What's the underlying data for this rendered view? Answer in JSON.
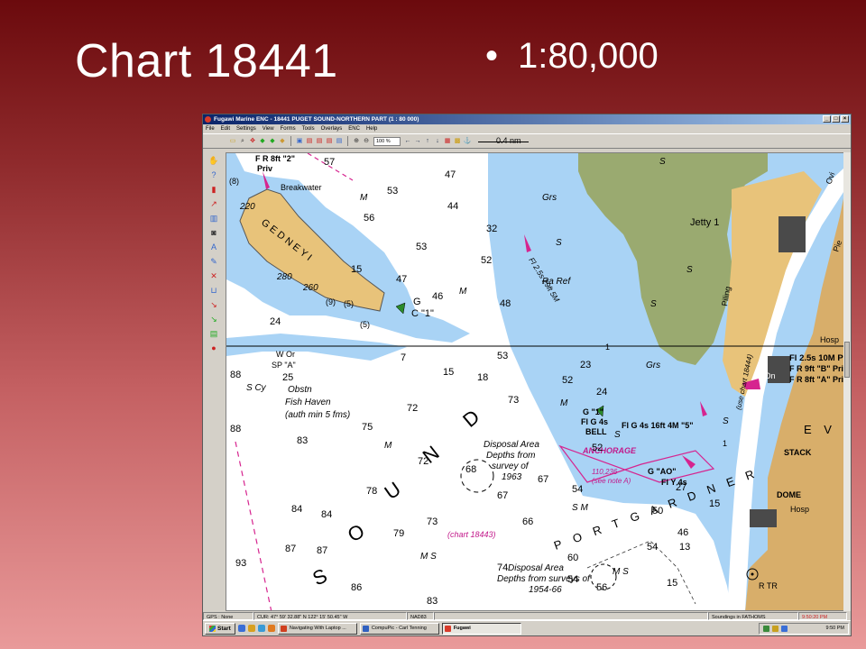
{
  "slide": {
    "title": "Chart 18441",
    "bullet": "1:80,000"
  },
  "window": {
    "title": "Fugawi Marine ENC - 18441 PUGET SOUND-NORTHERN PART (1 : 80 000)",
    "buttons": [
      "_",
      "□",
      "×"
    ]
  },
  "menu": [
    "File",
    "Edit",
    "Settings",
    "View",
    "Forms",
    "Tools",
    "Overlays",
    "ENC",
    "Help"
  ],
  "toolbar": {
    "zoom": "100 %",
    "scale_label": "0.4 nm"
  },
  "chart": {
    "colors": {
      "shallow": "#a9d3f5",
      "land": "#e8c37a",
      "marsh": "#9aaa70",
      "urban": "#d8ae6a",
      "magenta": "#d6248f"
    },
    "depths": [
      {
        "t": "57"
      },
      {
        "t": "47"
      },
      {
        "t": "53"
      },
      {
        "t": "44"
      },
      {
        "t": "56"
      },
      {
        "t": "53"
      },
      {
        "t": "32"
      },
      {
        "t": "52"
      },
      {
        "t": "15"
      },
      {
        "t": "47"
      },
      {
        "t": "46"
      },
      {
        "t": "48"
      },
      {
        "t": "24"
      },
      {
        "t": "7"
      },
      {
        "t": "53"
      },
      {
        "t": "15"
      },
      {
        "t": "18"
      },
      {
        "t": "52"
      },
      {
        "t": "23"
      },
      {
        "t": "88"
      },
      {
        "t": "25"
      },
      {
        "t": "73"
      },
      {
        "t": "72"
      },
      {
        "t": "75"
      },
      {
        "t": "88"
      },
      {
        "t": "83"
      },
      {
        "t": "24"
      },
      {
        "t": "52"
      },
      {
        "t": "72"
      },
      {
        "t": "68"
      },
      {
        "t": "67"
      },
      {
        "t": "67"
      },
      {
        "t": "78"
      },
      {
        "t": "54"
      },
      {
        "t": "84"
      },
      {
        "t": "84"
      },
      {
        "t": "79"
      },
      {
        "t": "73"
      },
      {
        "t": "66"
      },
      {
        "t": "50"
      },
      {
        "t": "46"
      },
      {
        "t": "87"
      },
      {
        "t": "87"
      },
      {
        "t": "93"
      },
      {
        "t": "54"
      },
      {
        "t": "13"
      },
      {
        "t": "60"
      },
      {
        "t": "74"
      },
      {
        "t": "54"
      },
      {
        "t": "86"
      },
      {
        "t": "83"
      },
      {
        "t": "56"
      },
      {
        "t": "27"
      },
      {
        "t": "15"
      },
      {
        "t": "15"
      }
    ],
    "labels": {
      "fr8ft2": "F R 8ft \"2\"",
      "priv": "Priv",
      "breakwater": "Breakwater",
      "elev220": "220",
      "elev280": "280",
      "elev260": "260",
      "gedney": "G E D N E Y   I",
      "g1": "G",
      "c1": "C \"1\"",
      "m1": "M",
      "grs1": "Grs",
      "s1": "S",
      "fl25": "Fl 2.5s 29ft 5M",
      "raref": "Ra Ref",
      "jetty": "Jetty 1",
      "wor": "W Or",
      "spa": "SP \"A\"",
      "scy": "S Cy",
      "obstn": "Obstn",
      "fishhaven": "Fish Haven",
      "authmin": "(auth min 5 fms)",
      "disp1": "Disposal Area",
      "disp1b": "Depths from",
      "disp1c": "survey of",
      "disp1d": "1963",
      "chart18443": "(chart 18443)",
      "disp2": "Disposal Area",
      "disp2b": "Depths from surveys of",
      "disp2c": "1954-66",
      "sound_s": "S",
      "sound_o": "O",
      "sound_u": "U",
      "sound_n": "N",
      "sound_d": "D",
      "portgardner": "P O R T   G A R D N E R",
      "anchorage": "ANCHORAGE",
      "seenote": "(see note A)",
      "g1bell1": "G \"1\"",
      "g1bell2": "Fl G 4s",
      "g1bell3": "BELL",
      "flg4s": "Fl G 4s 16ft 4M \"5\"",
      "fl25b": "Fl 2.5s 10M Priv",
      "fr8ftB": "F R 9ft \"B\" Priv",
      "fr8ftA": "F R 8ft \"A\" Priv",
      "stack": "STACK",
      "dome": "DOME",
      "hosp1": "Hosp",
      "hosp2": "Hosp",
      "rtr": "R TR",
      "eve": "E V E",
      "useChart": "(use chart 18444)",
      "piling": "Piling",
      "oyao": "G \"AO\"",
      "flyy": "Fl Y 4s",
      "hosp": "Hosp",
      "ms1": "M S",
      "ms2": "S M",
      "ms3": "M S",
      "grs2": "Grs",
      "s2": "S",
      "s3": "S",
      "s4": "S",
      "s5": "S",
      "s6": "S",
      "m2": "M",
      "m3": "M",
      "m4": "M",
      "one": "1",
      "one2": "1",
      "anchorage_num": "110,236",
      "five": "(5)",
      "five2": "(5)",
      "nine": "(9)",
      "p8": "(8)",
      "ovi": "Ovi",
      "pie": "Pie",
      "dn": "Dn"
    }
  },
  "status": {
    "gps": "GPS : None",
    "cur": "CUR: 47° 59' 32.88\" N 122° 15' 50.45\" W",
    "datum": "NAD83",
    "soundings": "Soundings in FATHOMS",
    "time": "9:50:20 PM"
  },
  "taskbar": {
    "start": "Start",
    "tasks": [
      "Navigating With Laptop ...",
      "CompuPic - Carl Tenning",
      "Fugawi"
    ],
    "clock": "9:50 PM"
  }
}
